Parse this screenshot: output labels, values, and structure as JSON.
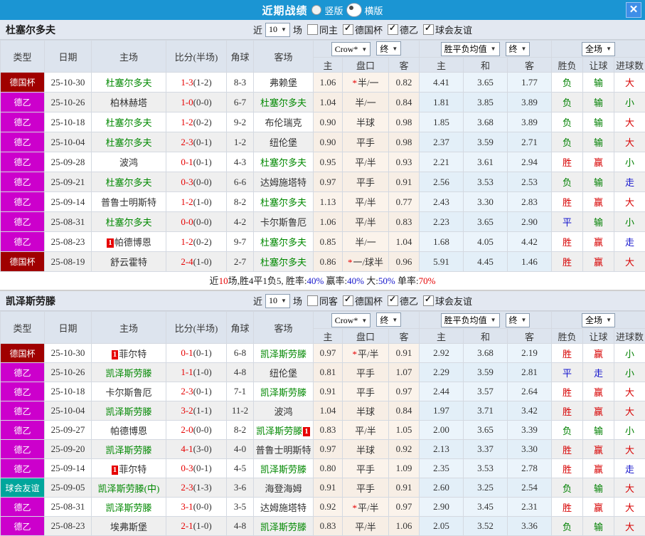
{
  "titlebar": {
    "title": "近期战绩",
    "options": [
      {
        "label": "竖版",
        "selected": false
      },
      {
        "label": "横版",
        "selected": true
      }
    ],
    "close": "✕"
  },
  "colors": {
    "titlebar_bg": "#1B95D3",
    "close_btn_bg": "#3E8EE8",
    "section_header_bg": "#E3E8F1",
    "table_header_bg": "#DDE4EE",
    "league_cup_bg": "#A00000",
    "league_l2_bg": "#CC00CC",
    "league_friendly_bg": "#00A69C",
    "crow_col_bg": "#FBF3EB",
    "avg_col_bg": "#EBF4FB",
    "win_red": "#D70000",
    "lose_green": "#008000",
    "draw_blue": "#1414CC",
    "score_red": "#E60000",
    "team_green": "#008800"
  },
  "headers": {
    "type": "类型",
    "date": "日期",
    "home": "主场",
    "score": "比分(半场)",
    "corner": "角球",
    "away": "客场",
    "odds_home": "主",
    "odds_line": "盘口",
    "odds_away": "客",
    "avg_home": "主",
    "avg_draw": "和",
    "avg_away": "客",
    "wdl": "胜负",
    "hcp": "让球",
    "goals": "进球数",
    "dd_crow": "Crow*",
    "dd_final1": "终",
    "dd_avg": "胜平负均值",
    "dd_final2": "终",
    "dd_full": "全场",
    "dd_arrow": "▼"
  },
  "sections": [
    {
      "team": "杜塞尔多夫",
      "filter": {
        "near": "近",
        "count": "10",
        "games": "场",
        "same_label": "同主",
        "same_checked": false,
        "leagues": [
          {
            "label": "德国杯",
            "checked": true
          },
          {
            "label": "德乙",
            "checked": true
          },
          {
            "label": "球会友谊",
            "checked": true
          }
        ]
      },
      "rows": [
        {
          "lg": "德国杯",
          "lgc": "cup",
          "date": "25-10-30",
          "h": {
            "n": "杜塞尔多夫",
            "g": true
          },
          "ft": "1-3",
          "ht": "(1-2)",
          "cn": "8-3",
          "a": {
            "n": "弗赖堡",
            "g": false
          },
          "oh": "1.06",
          "st": true,
          "ln": "半/一",
          "oa": "0.82",
          "m1": "4.41",
          "m2": "3.65",
          "m3": "1.77",
          "w": "负",
          "hc": "输",
          "gl": "大"
        },
        {
          "lg": "德乙",
          "lgc": "l2",
          "date": "25-10-26",
          "h": {
            "n": "柏林赫塔",
            "g": false
          },
          "ft": "1-0",
          "ht": "(0-0)",
          "cn": "6-7",
          "a": {
            "n": "杜塞尔多夫",
            "g": true
          },
          "oh": "1.04",
          "st": false,
          "ln": "半/一",
          "oa": "0.84",
          "m1": "1.81",
          "m2": "3.85",
          "m3": "3.89",
          "w": "负",
          "hc": "输",
          "gl": "小"
        },
        {
          "lg": "德乙",
          "lgc": "l2",
          "date": "25-10-18",
          "h": {
            "n": "杜塞尔多夫",
            "g": true
          },
          "ft": "1-2",
          "ht": "(0-2)",
          "cn": "9-2",
          "a": {
            "n": "布伦瑞克",
            "g": false
          },
          "oh": "0.90",
          "st": false,
          "ln": "半球",
          "oa": "0.98",
          "m1": "1.85",
          "m2": "3.68",
          "m3": "3.89",
          "w": "负",
          "hc": "输",
          "gl": "大"
        },
        {
          "lg": "德乙",
          "lgc": "l2",
          "date": "25-10-04",
          "h": {
            "n": "杜塞尔多夫",
            "g": true
          },
          "ft": "2-3",
          "ht": "(0-1)",
          "cn": "1-2",
          "a": {
            "n": "纽伦堡",
            "g": false
          },
          "oh": "0.90",
          "st": false,
          "ln": "平手",
          "oa": "0.98",
          "m1": "2.37",
          "m2": "3.59",
          "m3": "2.71",
          "w": "负",
          "hc": "输",
          "gl": "大"
        },
        {
          "lg": "德乙",
          "lgc": "l2",
          "date": "25-09-28",
          "h": {
            "n": "波鸿",
            "g": false
          },
          "ft": "0-1",
          "ht": "(0-1)",
          "cn": "4-3",
          "a": {
            "n": "杜塞尔多夫",
            "g": true
          },
          "oh": "0.95",
          "st": false,
          "ln": "平/半",
          "oa": "0.93",
          "m1": "2.21",
          "m2": "3.61",
          "m3": "2.94",
          "w": "胜",
          "hc": "赢",
          "gl": "小"
        },
        {
          "lg": "德乙",
          "lgc": "l2",
          "date": "25-09-21",
          "h": {
            "n": "杜塞尔多夫",
            "g": true
          },
          "ft": "0-3",
          "ht": "(0-0)",
          "cn": "6-6",
          "a": {
            "n": "达姆施塔特",
            "g": false
          },
          "oh": "0.97",
          "st": false,
          "ln": "平手",
          "oa": "0.91",
          "m1": "2.56",
          "m2": "3.53",
          "m3": "2.53",
          "w": "负",
          "hc": "输",
          "gl": "走"
        },
        {
          "lg": "德乙",
          "lgc": "l2",
          "date": "25-09-14",
          "h": {
            "n": "普鲁士明斯特",
            "g": false
          },
          "ft": "1-2",
          "ht": "(1-0)",
          "cn": "8-2",
          "a": {
            "n": "杜塞尔多夫",
            "g": true
          },
          "oh": "1.13",
          "st": false,
          "ln": "平/半",
          "oa": "0.77",
          "m1": "2.43",
          "m2": "3.30",
          "m3": "2.83",
          "w": "胜",
          "hc": "赢",
          "gl": "大"
        },
        {
          "lg": "德乙",
          "lgc": "l2",
          "date": "25-08-31",
          "h": {
            "n": "杜塞尔多夫",
            "g": true
          },
          "ft": "0-0",
          "ht": "(0-0)",
          "cn": "4-2",
          "a": {
            "n": "卡尔斯鲁厄",
            "g": false
          },
          "oh": "1.06",
          "st": false,
          "ln": "平/半",
          "oa": "0.83",
          "m1": "2.23",
          "m2": "3.65",
          "m3": "2.90",
          "w": "平",
          "hc": "输",
          "gl": "小"
        },
        {
          "lg": "德乙",
          "lgc": "l2",
          "date": "25-08-23",
          "h": {
            "n": "帕德博恩",
            "g": false,
            "b": "1",
            "bp": "b"
          },
          "ft": "1-2",
          "ht": "(0-2)",
          "cn": "9-7",
          "a": {
            "n": "杜塞尔多夫",
            "g": true
          },
          "oh": "0.85",
          "st": false,
          "ln": "半/一",
          "oa": "1.04",
          "m1": "1.68",
          "m2": "4.05",
          "m3": "4.42",
          "w": "胜",
          "hc": "赢",
          "gl": "走"
        },
        {
          "lg": "德国杯",
          "lgc": "cup",
          "date": "25-08-19",
          "h": {
            "n": "舒云霍特",
            "g": false
          },
          "ft": "2-4",
          "ht": "(1-0)",
          "cn": "2-7",
          "a": {
            "n": "杜塞尔多夫",
            "g": true
          },
          "oh": "0.86",
          "st": true,
          "ln": "一/球半",
          "oa": "0.96",
          "m1": "5.91",
          "m2": "4.45",
          "m3": "1.46",
          "w": "胜",
          "hc": "赢",
          "gl": "大"
        }
      ],
      "summary": [
        {
          "t": "近",
          "c": "k"
        },
        {
          "t": "10",
          "c": "r"
        },
        {
          "t": "场,胜4平1负5, 胜率:",
          "c": "k"
        },
        {
          "t": "40%",
          "c": "b"
        },
        {
          "t": " 赢率:",
          "c": "k"
        },
        {
          "t": "40%",
          "c": "b"
        },
        {
          "t": " 大:",
          "c": "k"
        },
        {
          "t": "50%",
          "c": "b"
        },
        {
          "t": " 单率:",
          "c": "k"
        },
        {
          "t": "70%",
          "c": "r"
        }
      ]
    },
    {
      "team": "凯泽斯劳滕",
      "filter": {
        "near": "近",
        "count": "10",
        "games": "场",
        "same_label": "同客",
        "same_checked": false,
        "leagues": [
          {
            "label": "德国杯",
            "checked": true
          },
          {
            "label": "德乙",
            "checked": true
          },
          {
            "label": "球会友谊",
            "checked": true
          }
        ]
      },
      "rows": [
        {
          "lg": "德国杯",
          "lgc": "cup",
          "date": "25-10-30",
          "h": {
            "n": "菲尔特",
            "g": false,
            "b": "1",
            "bp": "b"
          },
          "ft": "0-1",
          "ht": "(0-1)",
          "cn": "6-8",
          "a": {
            "n": "凯泽斯劳滕",
            "g": true
          },
          "oh": "0.97",
          "st": true,
          "ln": "平/半",
          "oa": "0.91",
          "m1": "2.92",
          "m2": "3.68",
          "m3": "2.19",
          "w": "胜",
          "hc": "赢",
          "gl": "小"
        },
        {
          "lg": "德乙",
          "lgc": "l2",
          "date": "25-10-26",
          "h": {
            "n": "凯泽斯劳滕",
            "g": true
          },
          "ft": "1-1",
          "ht": "(1-0)",
          "cn": "4-8",
          "a": {
            "n": "纽伦堡",
            "g": false
          },
          "oh": "0.81",
          "st": false,
          "ln": "平手",
          "oa": "1.07",
          "m1": "2.29",
          "m2": "3.59",
          "m3": "2.81",
          "w": "平",
          "hc": "走",
          "gl": "小"
        },
        {
          "lg": "德乙",
          "lgc": "l2",
          "date": "25-10-18",
          "h": {
            "n": "卡尔斯鲁厄",
            "g": false
          },
          "ft": "2-3",
          "ht": "(0-1)",
          "cn": "7-1",
          "a": {
            "n": "凯泽斯劳滕",
            "g": true
          },
          "oh": "0.91",
          "st": false,
          "ln": "平手",
          "oa": "0.97",
          "m1": "2.44",
          "m2": "3.57",
          "m3": "2.64",
          "w": "胜",
          "hc": "赢",
          "gl": "大"
        },
        {
          "lg": "德乙",
          "lgc": "l2",
          "date": "25-10-04",
          "h": {
            "n": "凯泽斯劳滕",
            "g": true
          },
          "ft": "3-2",
          "ht": "(1-1)",
          "cn": "11-2",
          "a": {
            "n": "波鸿",
            "g": false
          },
          "oh": "1.04",
          "st": false,
          "ln": "半球",
          "oa": "0.84",
          "m1": "1.97",
          "m2": "3.71",
          "m3": "3.42",
          "w": "胜",
          "hc": "赢",
          "gl": "大"
        },
        {
          "lg": "德乙",
          "lgc": "l2",
          "date": "25-09-27",
          "h": {
            "n": "帕德博恩",
            "g": false
          },
          "ft": "2-0",
          "ht": "(0-0)",
          "cn": "8-2",
          "a": {
            "n": "凯泽斯劳滕",
            "g": true,
            "b": "1",
            "bp": "a"
          },
          "oh": "0.83",
          "st": false,
          "ln": "平/半",
          "oa": "1.05",
          "m1": "2.00",
          "m2": "3.65",
          "m3": "3.39",
          "w": "负",
          "hc": "输",
          "gl": "小"
        },
        {
          "lg": "德乙",
          "lgc": "l2",
          "date": "25-09-20",
          "h": {
            "n": "凯泽斯劳滕",
            "g": true
          },
          "ft": "4-1",
          "ht": "(3-0)",
          "cn": "4-0",
          "a": {
            "n": "普鲁士明斯特",
            "g": false
          },
          "oh": "0.97",
          "st": false,
          "ln": "半球",
          "oa": "0.92",
          "m1": "2.13",
          "m2": "3.37",
          "m3": "3.30",
          "w": "胜",
          "hc": "赢",
          "gl": "大"
        },
        {
          "lg": "德乙",
          "lgc": "l2",
          "date": "25-09-14",
          "h": {
            "n": "菲尔特",
            "g": false,
            "b": "1",
            "bp": "b"
          },
          "ft": "0-3",
          "ht": "(0-1)",
          "cn": "4-5",
          "a": {
            "n": "凯泽斯劳滕",
            "g": true
          },
          "oh": "0.80",
          "st": false,
          "ln": "平手",
          "oa": "1.09",
          "m1": "2.35",
          "m2": "3.53",
          "m3": "2.78",
          "w": "胜",
          "hc": "赢",
          "gl": "走"
        },
        {
          "lg": "球会友谊",
          "lgc": "fr",
          "date": "25-09-05",
          "h": {
            "n": "凯泽斯劳滕(中)",
            "g": true
          },
          "ft": "2-3",
          "ht": "(1-3)",
          "cn": "3-6",
          "a": {
            "n": "海登海姆",
            "g": false
          },
          "oh": "0.91",
          "st": false,
          "ln": "平手",
          "oa": "0.91",
          "m1": "2.60",
          "m2": "3.25",
          "m3": "2.54",
          "w": "负",
          "hc": "输",
          "gl": "大"
        },
        {
          "lg": "德乙",
          "lgc": "l2",
          "date": "25-08-31",
          "h": {
            "n": "凯泽斯劳滕",
            "g": true
          },
          "ft": "3-1",
          "ht": "(0-0)",
          "cn": "3-5",
          "a": {
            "n": "达姆施塔特",
            "g": false
          },
          "oh": "0.92",
          "st": true,
          "ln": "平/半",
          "oa": "0.97",
          "m1": "2.90",
          "m2": "3.45",
          "m3": "2.31",
          "w": "胜",
          "hc": "赢",
          "gl": "大"
        },
        {
          "lg": "德乙",
          "lgc": "l2",
          "date": "25-08-23",
          "h": {
            "n": "埃弗斯堡",
            "g": false
          },
          "ft": "2-1",
          "ht": "(1-0)",
          "cn": "4-8",
          "a": {
            "n": "凯泽斯劳滕",
            "g": true
          },
          "oh": "0.83",
          "st": false,
          "ln": "平/半",
          "oa": "1.06",
          "m1": "2.05",
          "m2": "3.52",
          "m3": "3.36",
          "w": "负",
          "hc": "输",
          "gl": "大"
        }
      ]
    }
  ]
}
